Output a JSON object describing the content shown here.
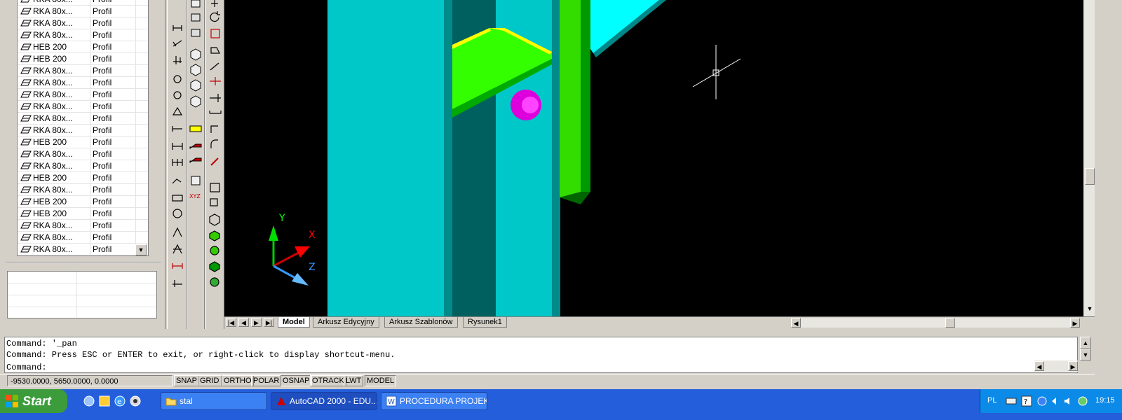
{
  "object_list": {
    "rows": [
      {
        "name": "RKA 80x...",
        "type": "Profil"
      },
      {
        "name": "RKA 80x...",
        "type": "Profil"
      },
      {
        "name": "RKA 80x...",
        "type": "Profil"
      },
      {
        "name": "RKA 80x...",
        "type": "Profil"
      },
      {
        "name": "HEB 200",
        "type": "Profil"
      },
      {
        "name": "HEB 200",
        "type": "Profil"
      },
      {
        "name": "RKA 80x...",
        "type": "Profil"
      },
      {
        "name": "RKA 80x...",
        "type": "Profil"
      },
      {
        "name": "RKA 80x...",
        "type": "Profil"
      },
      {
        "name": "RKA 80x...",
        "type": "Profil"
      },
      {
        "name": "RKA 80x...",
        "type": "Profil"
      },
      {
        "name": "RKA 80x...",
        "type": "Profil"
      },
      {
        "name": "HEB 200",
        "type": "Profil"
      },
      {
        "name": "RKA 80x...",
        "type": "Profil"
      },
      {
        "name": "RKA 80x...",
        "type": "Profil"
      },
      {
        "name": "HEB 200",
        "type": "Profil"
      },
      {
        "name": "RKA 80x...",
        "type": "Profil"
      },
      {
        "name": "HEB 200",
        "type": "Profil"
      },
      {
        "name": "HEB 200",
        "type": "Profil"
      },
      {
        "name": "RKA 80x...",
        "type": "Profil"
      },
      {
        "name": "RKA 80x...",
        "type": "Profil"
      },
      {
        "name": "RKA 80x...",
        "type": "Profil"
      }
    ]
  },
  "ucs": {
    "x_label": "X",
    "y_label": "Y",
    "z_label": "Z"
  },
  "layout_tabs": {
    "tabs": [
      "Model",
      "Arkusz Edycyjny",
      "Arkusz Szablonów",
      "Rysunek1"
    ],
    "active": "Model",
    "nav": {
      "first": "|◀",
      "prev": "◀",
      "next": "▶",
      "last": "▶|"
    }
  },
  "command_window": {
    "lines": [
      "Command: '_pan",
      "Command: Press ESC or ENTER to exit, or right-click to display shortcut-menu.",
      "Command:"
    ]
  },
  "status_bar": {
    "coordinates": "-9530.0000, 5650.0000, 0.0000",
    "toggles": [
      {
        "label": "SNAP",
        "on": false
      },
      {
        "label": "GRID",
        "on": false
      },
      {
        "label": "ORTHO",
        "on": false
      },
      {
        "label": "POLAR",
        "on": false
      },
      {
        "label": "OSNAP",
        "on": true
      },
      {
        "label": "OTRACK",
        "on": false
      },
      {
        "label": "LWT",
        "on": false
      },
      {
        "label": "MODEL",
        "on": true
      }
    ]
  },
  "taskbar": {
    "start_label": "Start",
    "quick_launch": [
      "desktop-icon",
      "media-icon",
      "ie-icon",
      "player-icon"
    ],
    "tasks": [
      {
        "label": "stal",
        "icon": "folder-icon",
        "active": false
      },
      {
        "label": "AutoCAD 2000 - EDU...",
        "icon": "autocad-icon",
        "active": true
      },
      {
        "label": "PROCEDURA PROJEK...",
        "icon": "word-icon",
        "active": false
      }
    ],
    "tray": {
      "language": "PL",
      "clock": "19:15"
    }
  },
  "colors": {
    "viewport_bg": "#000000",
    "column_cyan": "#00c8c8",
    "beam_green": "#33ff00",
    "bolt_magenta": "#ff00ff",
    "taskbar_blue": "#245edb",
    "start_green": "#3c9c3c"
  }
}
